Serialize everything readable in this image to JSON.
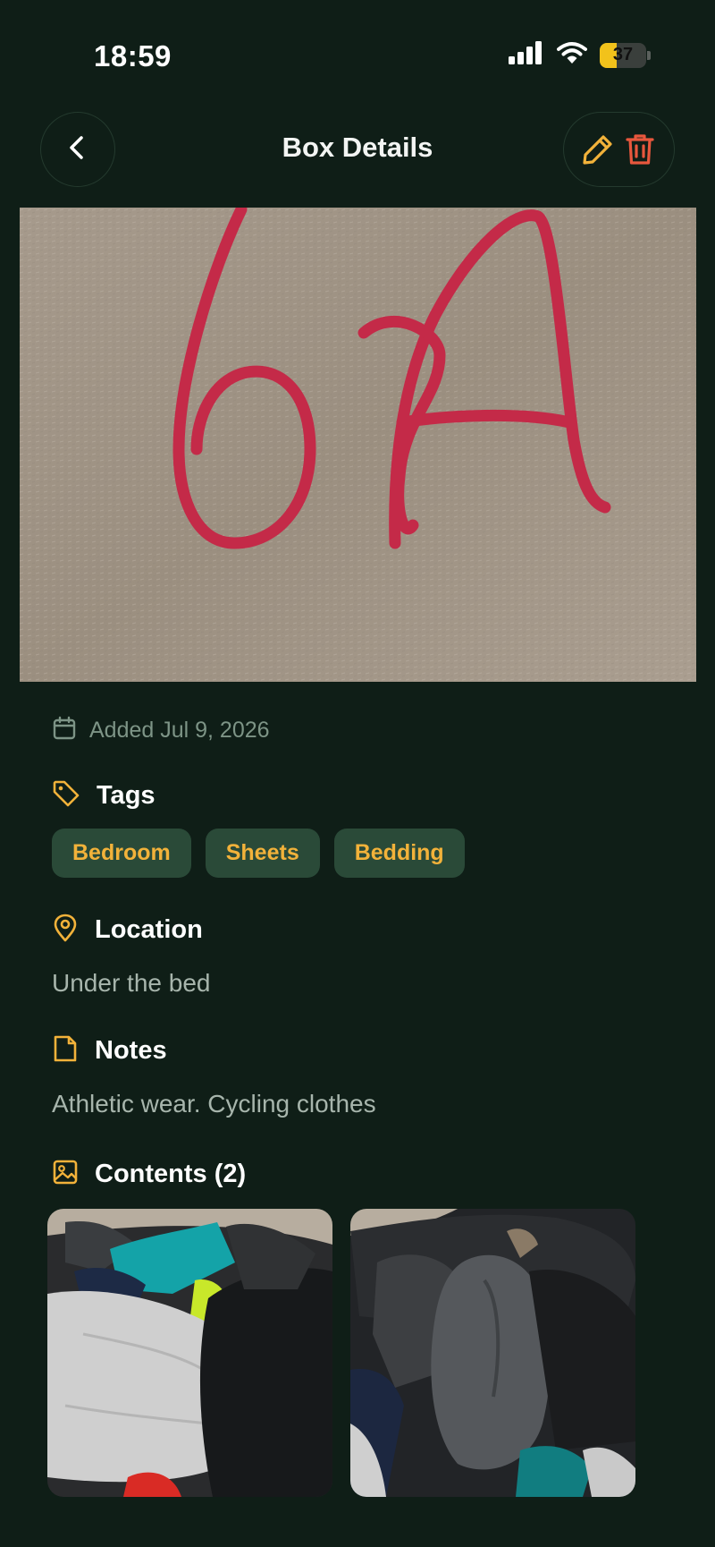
{
  "status": {
    "time": "18:59",
    "battery": "37",
    "battery_level": 0.37
  },
  "header": {
    "title": "Box Details",
    "back_icon": "chevron-left-icon",
    "edit_icon": "pencil-icon",
    "delete_icon": "trash-icon"
  },
  "hero": {
    "handwritten_label": "6A"
  },
  "details": {
    "added_text": "Added Jul 9, 2026",
    "tags_heading": "Tags",
    "tags": [
      "Bedroom",
      "Sheets",
      "Bedding"
    ],
    "location_heading": "Location",
    "location_value": "Under the bed",
    "notes_heading": "Notes",
    "notes_value": "Athletic wear. Cycling clothes",
    "contents_heading": "Contents (2)"
  },
  "colors": {
    "background": "#0f1e17",
    "accent": "#f2b23a",
    "delete": "#e8573d",
    "tag_bg": "#2a4a38",
    "muted_text": "#7d9486"
  }
}
